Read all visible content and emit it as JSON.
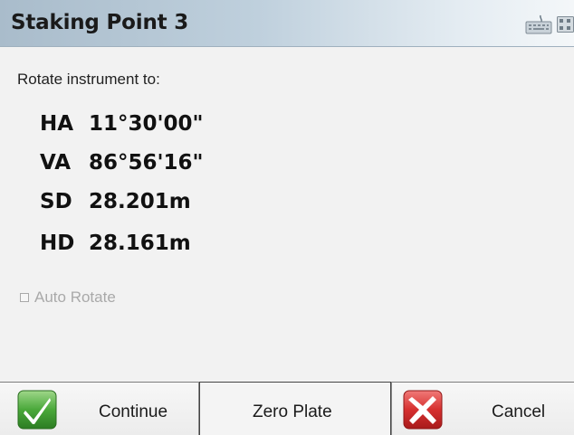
{
  "window": {
    "title": "Staking Point 3",
    "icons": [
      "keyboard-icon",
      "grid-icon"
    ]
  },
  "main": {
    "prompt": "Rotate instrument to:",
    "readings": [
      {
        "label": "HA",
        "value": "11°30'00\""
      },
      {
        "label": "VA",
        "value": "86°56'16\""
      },
      {
        "label": "SD",
        "value": "28.201m"
      },
      {
        "label": "HD",
        "value": "28.161m"
      }
    ],
    "auto_rotate": {
      "label": "Auto Rotate",
      "checked": false,
      "enabled": false
    }
  },
  "buttons": {
    "continue": {
      "label": "Continue",
      "icon": "checkmark-icon",
      "icon_color": "#3e9b2c"
    },
    "zero_plate": {
      "label": "Zero Plate"
    },
    "cancel": {
      "label": "Cancel",
      "icon": "x-icon",
      "icon_color": "#d0282a"
    }
  }
}
